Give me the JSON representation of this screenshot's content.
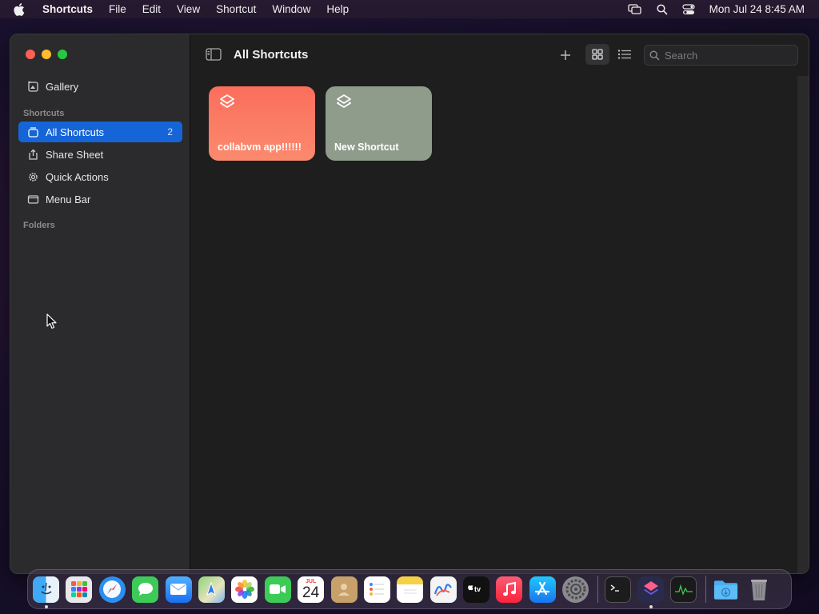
{
  "menubar": {
    "app_name": "Shortcuts",
    "menus": [
      "File",
      "Edit",
      "View",
      "Shortcut",
      "Window",
      "Help"
    ],
    "clock": "Mon Jul 24  8:45 AM"
  },
  "sidebar": {
    "gallery_label": "Gallery",
    "shortcuts_header": "Shortcuts",
    "items": [
      {
        "label": "All Shortcuts",
        "count": "2",
        "icon": "all-shortcuts-icon"
      },
      {
        "label": "Share Sheet",
        "icon": "share-icon"
      },
      {
        "label": "Quick Actions",
        "icon": "gear-icon"
      },
      {
        "label": "Menu Bar",
        "icon": "menubar-icon"
      }
    ],
    "folders_header": "Folders"
  },
  "toolbar": {
    "title": "All Shortcuts",
    "search_placeholder": "Search"
  },
  "shortcuts": [
    {
      "label": "collabvm app!!!!!!",
      "color": "#fb7a63"
    },
    {
      "label": "New Shortcut",
      "color": "#8f9c8c"
    }
  ],
  "calendar": {
    "month": "JUL",
    "day": "24"
  },
  "colors": {
    "accent": "#1565d8",
    "close": "#fe5f57",
    "minimize": "#febc2e",
    "maximize": "#28c840"
  },
  "dock": [
    "finder-icon",
    "launchpad-icon",
    "safari-icon",
    "messages-icon",
    "mail-icon",
    "maps-icon",
    "photos-icon",
    "facetime-icon",
    "calendar-icon",
    "contacts-icon",
    "reminders-icon",
    "notes-icon",
    "freeform-icon",
    "apple-tv-icon",
    "music-icon",
    "app-store-icon",
    "system-settings-icon",
    "terminal-icon",
    "shortcuts-icon",
    "activity-monitor-icon",
    "downloads-folder-icon",
    "trash-icon"
  ]
}
